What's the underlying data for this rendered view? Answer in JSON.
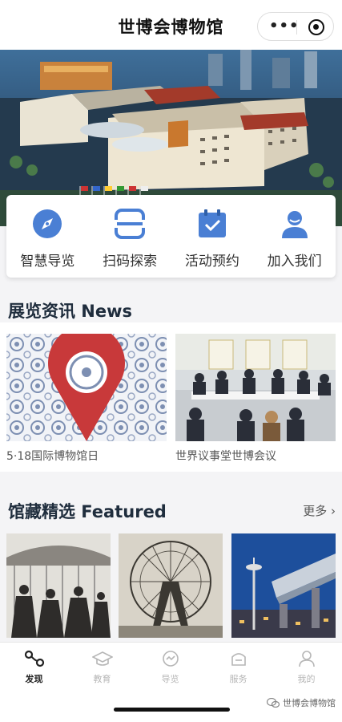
{
  "header": {
    "title": "世博会博物馆"
  },
  "quick_menu": [
    {
      "label": "智慧导览",
      "icon": "compass-icon"
    },
    {
      "label": "扫码探索",
      "icon": "scan-icon"
    },
    {
      "label": "活动预约",
      "icon": "calendar-check-icon"
    },
    {
      "label": "加入我们",
      "icon": "user-icon"
    }
  ],
  "news": {
    "title": "展览资讯 News",
    "items": [
      {
        "caption": "5·18国际博物馆日"
      },
      {
        "caption": "世界议事堂世博会议"
      }
    ]
  },
  "featured": {
    "title": "馆藏精选 Featured",
    "more_label": "更多"
  },
  "tabbar": [
    {
      "label": "发现",
      "icon": "discover-icon",
      "active": true
    },
    {
      "label": "教育",
      "icon": "graduation-cap-icon",
      "active": false
    },
    {
      "label": "导览",
      "icon": "guide-icon",
      "active": false
    },
    {
      "label": "服务",
      "icon": "service-icon",
      "active": false
    },
    {
      "label": "我的",
      "icon": "profile-icon",
      "active": false
    }
  ],
  "watermark": {
    "text": "世博会博物馆"
  },
  "colors": {
    "accent": "#4a7fd4",
    "title_text": "#1f2d3d",
    "pin_red": "#c8393a"
  }
}
